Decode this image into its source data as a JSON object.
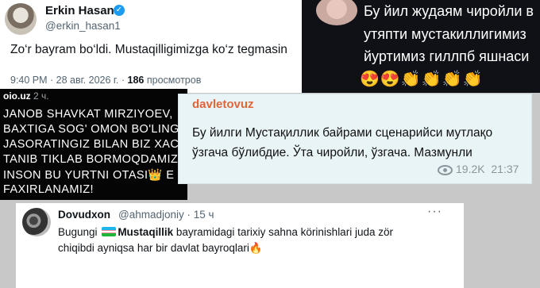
{
  "post_x": {
    "name": "Erkin Hasan",
    "verified_icon": "verified-badge-icon",
    "handle": "@erkin_hasan1",
    "text": "Zo‘r bayram bo‘ldi. Mustaqilligimizga ko‘z tegmasin",
    "time": "9:40 PM",
    "date": "28 авг. 2026 г.",
    "views_count": "186",
    "views_label": "просмотров"
  },
  "dark_comment": {
    "lines": [
      "Бу йил жудаям чиройли в",
      "утяпти мустакиллигимиз",
      "йуртимиз гиллпб яшнаси"
    ],
    "emojis": "😍😍👏👏👏👏"
  },
  "oio_post": {
    "source": "oio.uz",
    "time": "2 ч.",
    "lines": [
      "JANOB SHAVKAT MIRZIYOEV,",
      "BAXTIGA SOG' OMON BO'LING",
      "JASORATINGIZ BILAN BIZ XAC",
      "TANIB TIKLAB  BORMOQDAMIZ",
      "INSON BU YURTNI OTASI👑 E",
      "FAXIRLANAMIZ!"
    ]
  },
  "telegram_comment": {
    "author": "davletovuz",
    "lines": [
      "Бу йилги Мустақиллик байрами сценарийси мутлақо",
      "ўзгача бўлибдие. Ўта чиройли, ўзгача. Мазмунли"
    ],
    "views": "19.2K",
    "time": "21:37"
  },
  "reply_x": {
    "name": "Dovudxon",
    "handle": "@ahmadjoniy",
    "time": "· 15 ч",
    "more_icon": "more-options-icon",
    "line1_start": "Bugungi",
    "line1_bold": "Mustaqillik",
    "line1_end": "bayramidagi tarixiy sahna körinishlari juda zör",
    "line2": "chiqibdi ayniqsa har bir davlat bayroqlari🔥"
  }
}
